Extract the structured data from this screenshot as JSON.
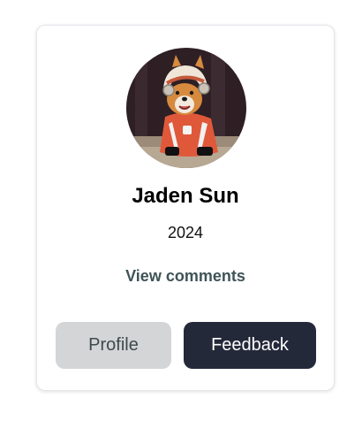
{
  "profile": {
    "name": "Jaden Sun",
    "year": "2024",
    "comments_link": "View comments",
    "avatar_icon": "corgi-avatar-image"
  },
  "actions": {
    "profile_label": "Profile",
    "feedback_label": "Feedback"
  },
  "colors": {
    "feedback_button_bg": "#24293a",
    "profile_button_bg": "#d4d5d6",
    "link_color": "#3f5358"
  }
}
